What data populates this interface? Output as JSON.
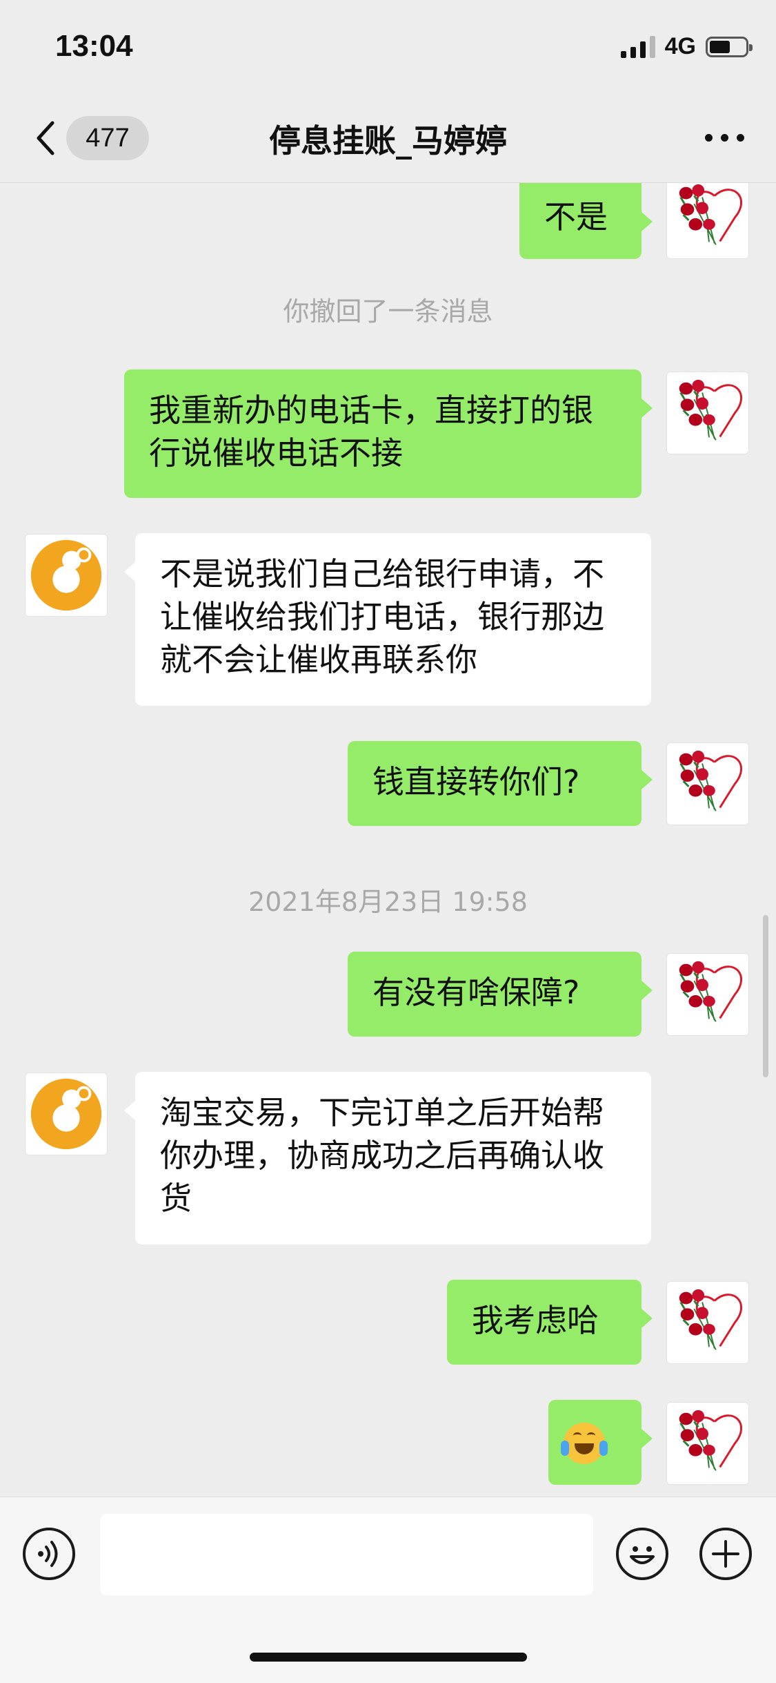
{
  "status": {
    "time": "13:04",
    "network": "4G",
    "battery_level": 0.55
  },
  "nav": {
    "badge": "477",
    "title": "停息挂账_马婷婷"
  },
  "messages": {
    "m1": "不是",
    "sys1": "你撤回了一条消息",
    "m2": "我重新办的电话卡，直接打的银行说催收电话不接",
    "m3": "不是说我们自己给银行申请，不让催收给我们打电话，银行那边就不会让催收再联系你",
    "m4": "钱直接转你们?",
    "time1": "2021年8月23日 19:58",
    "m5": "有没有啥保障?",
    "m6": "淘宝交易，下完订单之后开始帮你办理，协商成功之后再确认收货",
    "m7": "我考虑哈",
    "m8": "😭"
  },
  "colors": {
    "me_bubble": "#95ec69",
    "them_bubble": "#ffffff",
    "background": "#ededed",
    "avatar_orange": "#f2a51e",
    "rose": "#c8102e"
  },
  "icons": {
    "back": "chevron-left-icon",
    "more": "more-dots-icon",
    "voice": "voice-icon",
    "emoji": "emoji-icon",
    "plus": "plus-icon"
  }
}
